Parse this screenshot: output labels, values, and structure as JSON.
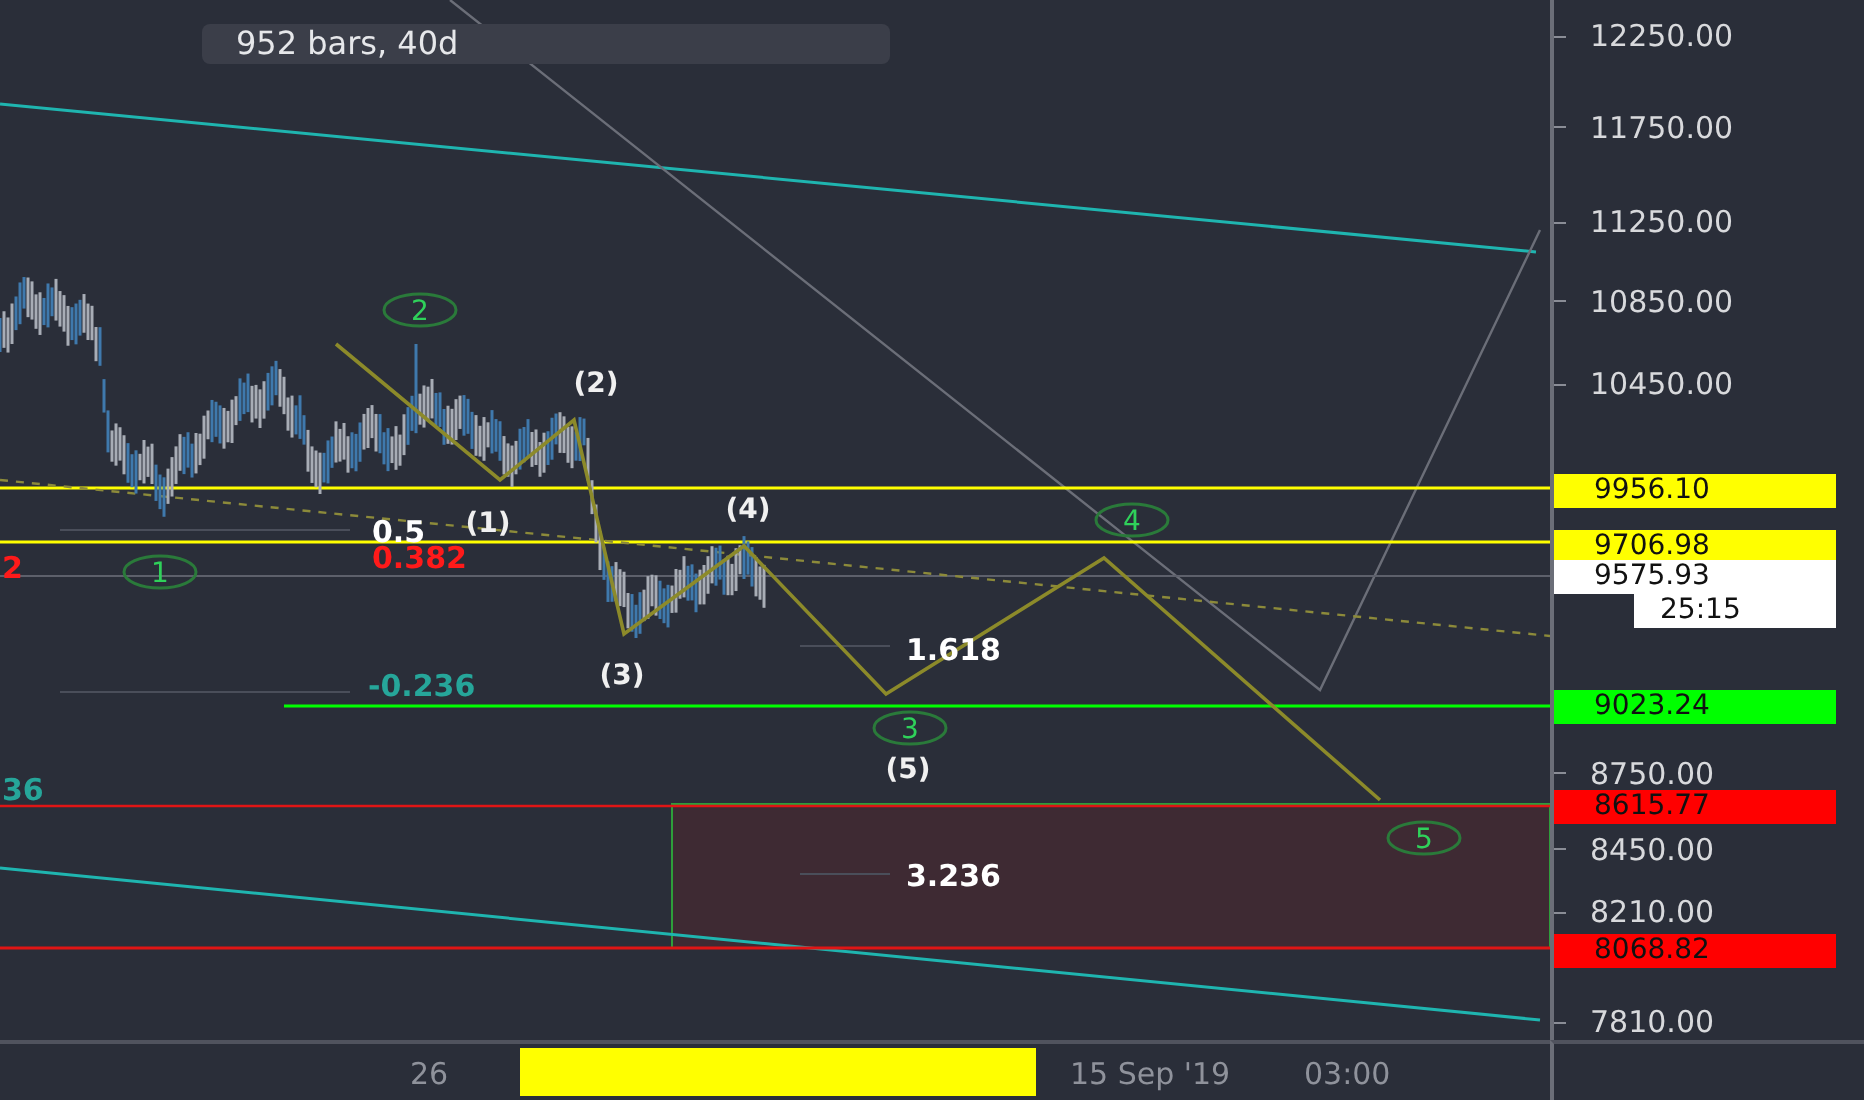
{
  "chart": {
    "info_badge": "952 bars, 40d",
    "wave_labels": [
      {
        "text": "2",
        "kind": "circled"
      },
      {
        "text": "(2)",
        "kind": "plain"
      },
      {
        "text": "(1)",
        "kind": "plain"
      },
      {
        "text": "(4)",
        "kind": "plain"
      },
      {
        "text": "(3)",
        "kind": "plain"
      },
      {
        "text": "(5)",
        "kind": "plain"
      },
      {
        "text": "1",
        "kind": "circled"
      },
      {
        "text": "4",
        "kind": "circled"
      },
      {
        "text": "3",
        "kind": "circled"
      },
      {
        "text": "5",
        "kind": "circled"
      }
    ],
    "fib_labels": [
      {
        "text": "0.5",
        "color": "#ffffff"
      },
      {
        "text": "2",
        "color": "#ff1a1a"
      },
      {
        "text": "0.382",
        "color": "#ff1a1a"
      },
      {
        "text": "-0.236",
        "color": "#26a69a"
      },
      {
        "text": "1.618",
        "color": "#ffffff"
      },
      {
        "text": "36",
        "color": "#26a69a"
      },
      {
        "text": "3.236",
        "color": "#ffffff"
      }
    ]
  },
  "price_axis": {
    "ticks": [
      "12250.00",
      "11750.00",
      "11250.00",
      "10850.00",
      "10450.00",
      "8750.00",
      "8450.00",
      "8210.00",
      "7810.00"
    ],
    "tags": [
      {
        "text": "9956.10",
        "color": "#ffff00",
        "kind": "price"
      },
      {
        "text": "9706.98",
        "color": "#ffff00",
        "kind": "price"
      },
      {
        "text": "9575.93",
        "color": "#ffffff",
        "kind": "price"
      },
      {
        "text": "25:15",
        "color": "#ffffff",
        "kind": "countdown"
      },
      {
        "text": "9023.24",
        "color": "#00ff00",
        "kind": "price"
      },
      {
        "text": "8615.77",
        "color": "#ff0000",
        "kind": "price"
      },
      {
        "text": "8068.82",
        "color": "#ff0000",
        "kind": "price"
      }
    ]
  },
  "time_axis": {
    "range_highlight": true,
    "labels": [
      "26",
      "15 Sep '19",
      "03:00"
    ]
  }
}
